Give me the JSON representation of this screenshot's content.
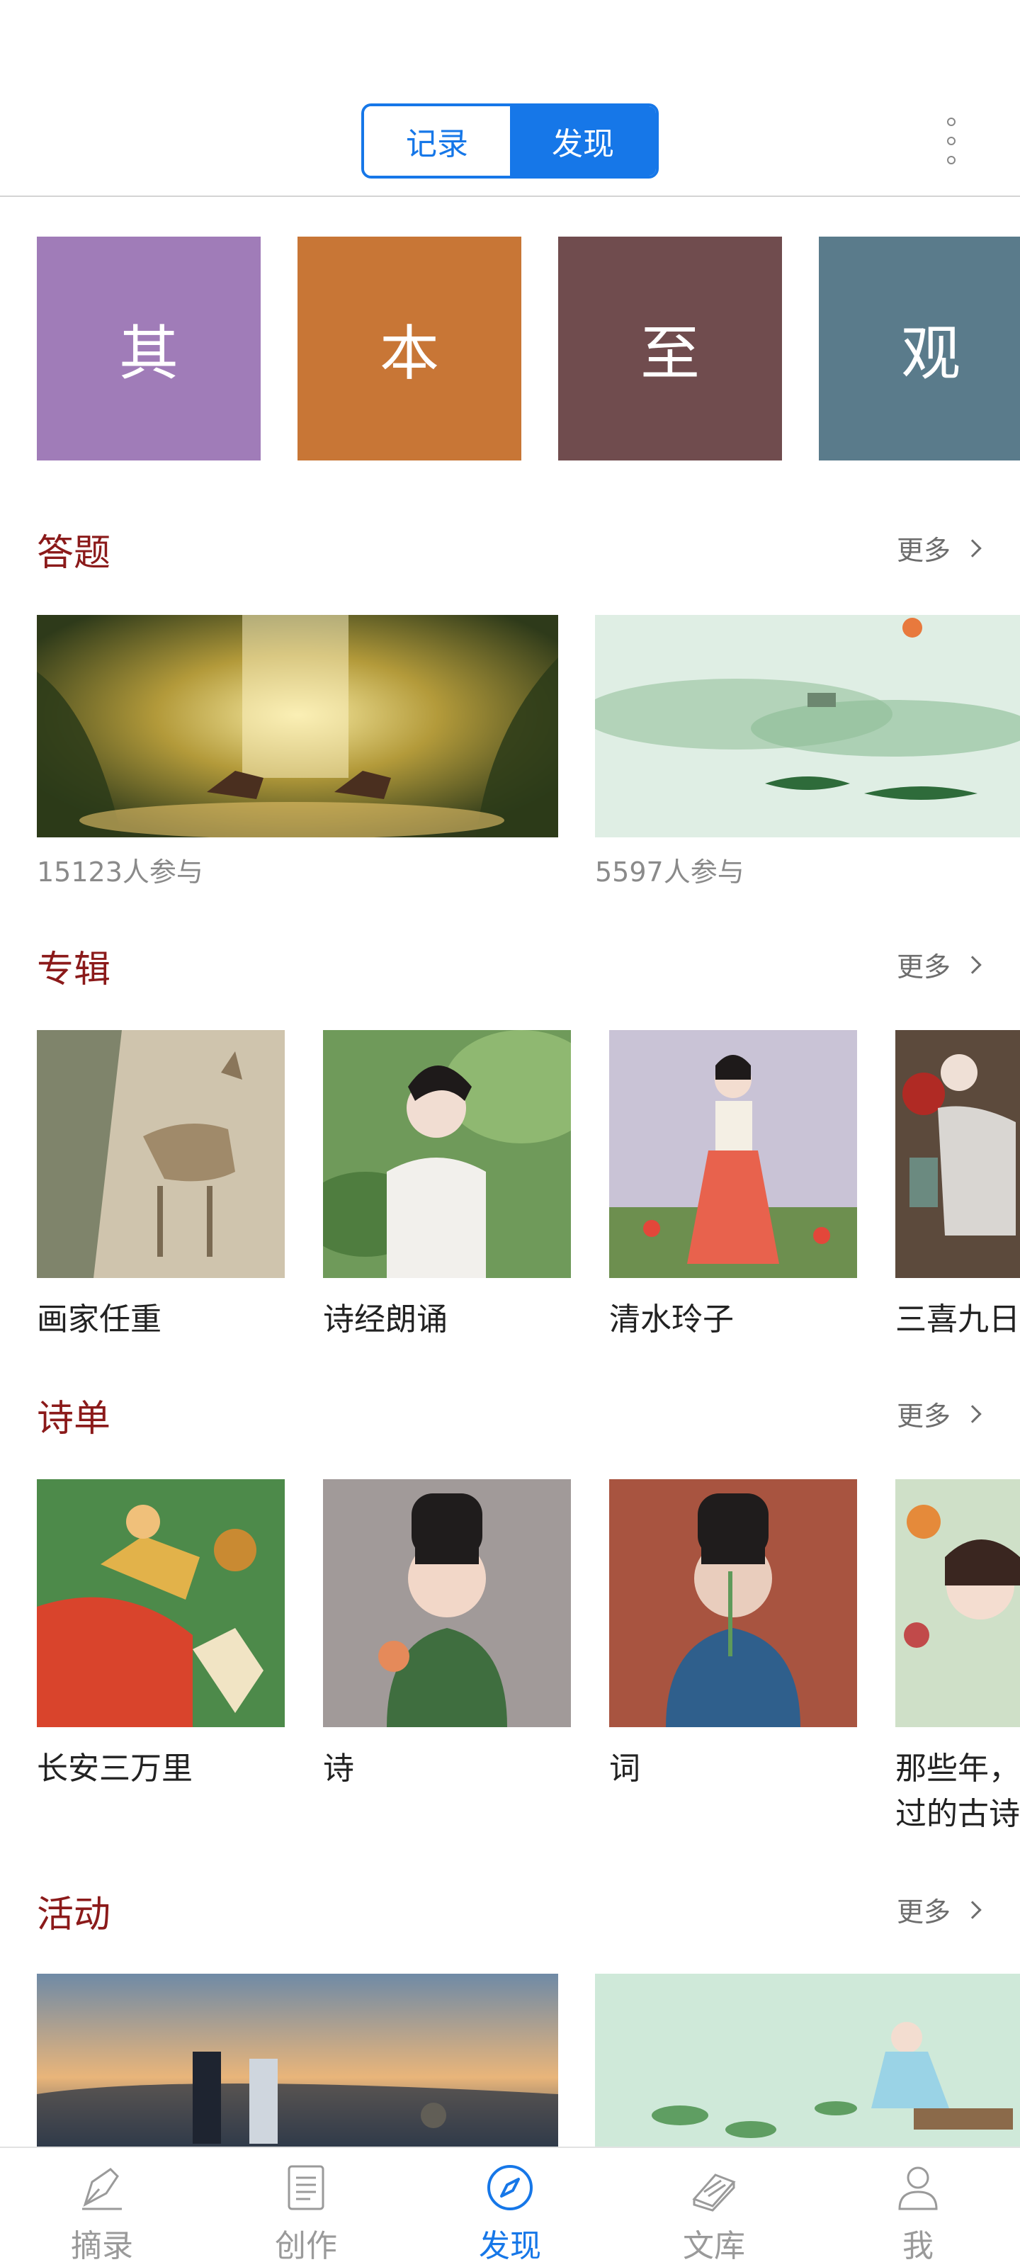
{
  "header": {
    "tabs": [
      {
        "label": "记录",
        "active": false
      },
      {
        "label": "发现",
        "active": true
      }
    ],
    "more_icon": "more-vertical-icon"
  },
  "tiles": [
    {
      "char": "其",
      "color": "#a07cb8"
    },
    {
      "char": "本",
      "color": "#c87636"
    },
    {
      "char": "至",
      "color": "#704c4e"
    },
    {
      "char": "观",
      "color": "#5a7b8b"
    }
  ],
  "sections": {
    "quiz": {
      "title": "答题",
      "more": "更多",
      "items": [
        {
          "count": "15123人参与"
        },
        {
          "count": "5597人参与"
        }
      ]
    },
    "album": {
      "title": "专辑",
      "more": "更多",
      "items": [
        {
          "title": "画家任重"
        },
        {
          "title": "诗经朗诵"
        },
        {
          "title": "清水玲子"
        },
        {
          "title": "三喜九日"
        }
      ]
    },
    "poem_list": {
      "title": "诗单",
      "more": "更多",
      "items": [
        {
          "title": "长安三万里"
        },
        {
          "title": "诗"
        },
        {
          "title": "词"
        },
        {
          "title": "那些年，",
          "title2": "过的古诗"
        }
      ]
    },
    "activity": {
      "title": "活动",
      "more": "更多"
    }
  },
  "tabbar": {
    "items": [
      {
        "label": "摘录",
        "icon": "quill-pen-icon",
        "active": false
      },
      {
        "label": "创作",
        "icon": "document-icon",
        "active": false
      },
      {
        "label": "发现",
        "icon": "compass-icon",
        "active": true
      },
      {
        "label": "文库",
        "icon": "books-icon",
        "active": false
      },
      {
        "label": "我",
        "icon": "user-icon",
        "active": false
      }
    ],
    "active_color": "#1677e8",
    "inactive_color": "#9a9a9a"
  },
  "accent": "#1677e8",
  "section_title_color": "#8b1a1a"
}
